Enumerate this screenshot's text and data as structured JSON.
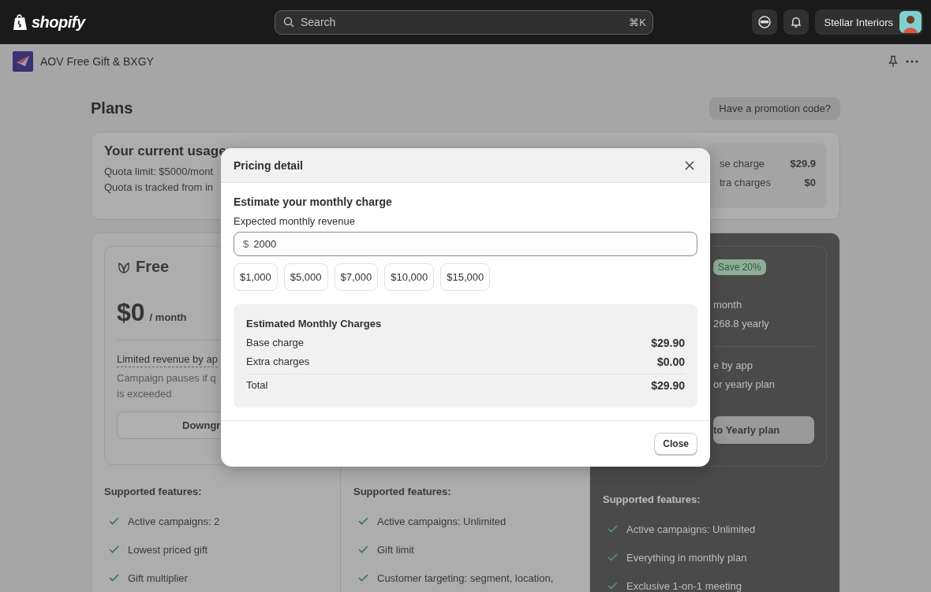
{
  "topbar": {
    "logo": "shopify",
    "search": {
      "placeholder": "Search",
      "shortcut": "⌘K"
    },
    "store": "Stellar Interiors"
  },
  "app_bar": {
    "title": "AOV Free Gift & BXGY"
  },
  "page": {
    "title": "Plans",
    "promo_button": "Have a promotion code?"
  },
  "usage": {
    "title": "Your current usage",
    "lines": [
      "Quota limit: $5000/mont",
      "Quota is tracked from in"
    ],
    "charges": [
      {
        "label": "se charge",
        "value": "$29.9"
      },
      {
        "label": "tra charges",
        "value": "$0"
      }
    ]
  },
  "plans": [
    {
      "highlighted": false,
      "name": "Free",
      "price": "$0",
      "period": "/ month",
      "limit_title": "Limited revenue by ap",
      "limit_note": "Campaign pauses if q\nis exceeded",
      "button": "Downgr",
      "features_title": "Supported features:",
      "features": [
        "Active campaigns: 2",
        "Lowest priced gift",
        "Gift multiplier"
      ]
    },
    {
      "highlighted": false,
      "features_title": "Supported features:",
      "features": [
        "Active campaigns: Unlimited",
        "Gift limit",
        "Customer targeting: segment, location,"
      ]
    },
    {
      "highlighted": true,
      "badge": "Save 20%",
      "price_lines": [
        "month",
        "268.8 yearly"
      ],
      "notes": [
        "e by app",
        "or yearly plan"
      ],
      "button": "to Yearly plan",
      "features_title": "Supported features:",
      "features": [
        "Active campaigns: Unlimited",
        "Everything in monthly plan",
        "Exclusive 1-on-1 meeting"
      ]
    }
  ],
  "modal": {
    "title": "Pricing detail",
    "section_title": "Estimate your monthly charge",
    "field_label": "Expected monthly revenue",
    "prefix": "$",
    "value": "2000",
    "presets": [
      "$1,000",
      "$5,000",
      "$7,000",
      "$10,000",
      "$15,000"
    ],
    "summary": {
      "title": "Estimated Monthly Charges",
      "rows": [
        {
          "label": "Base charge",
          "value": "$29.90"
        },
        {
          "label": "Extra charges",
          "value": "$0.00"
        }
      ],
      "total": {
        "label": "Total",
        "value": "$29.90"
      }
    },
    "close_button": "Close"
  }
}
